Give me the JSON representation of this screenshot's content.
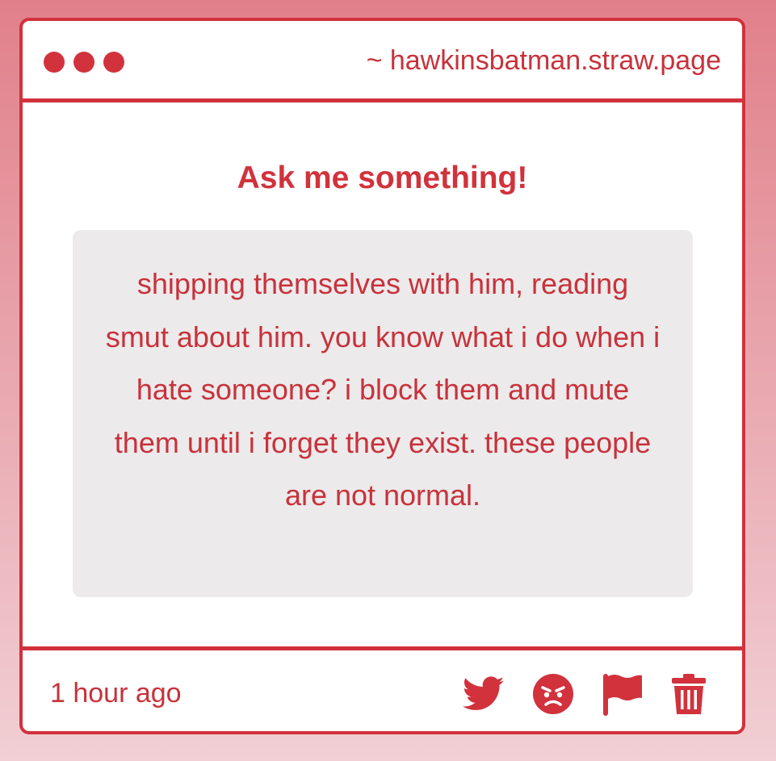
{
  "window": {
    "url": "~ hawkinsbatman.straw.page"
  },
  "main": {
    "heading": "Ask me something!",
    "question": "shipping themselves with him, reading smut about him. you know what i do when i hate someone? i block them and mute them until i forget they exist. these people are not normal."
  },
  "footer": {
    "timestamp": "1 hour ago",
    "actions": [
      "twitter-icon",
      "angry-face-icon",
      "flag-icon",
      "trash-icon"
    ]
  },
  "colors": {
    "accent": "#d1323c",
    "box_background": "#eceaeb",
    "page_gradient_top": "#e1808a",
    "page_gradient_bottom": "#f1cfd4"
  }
}
